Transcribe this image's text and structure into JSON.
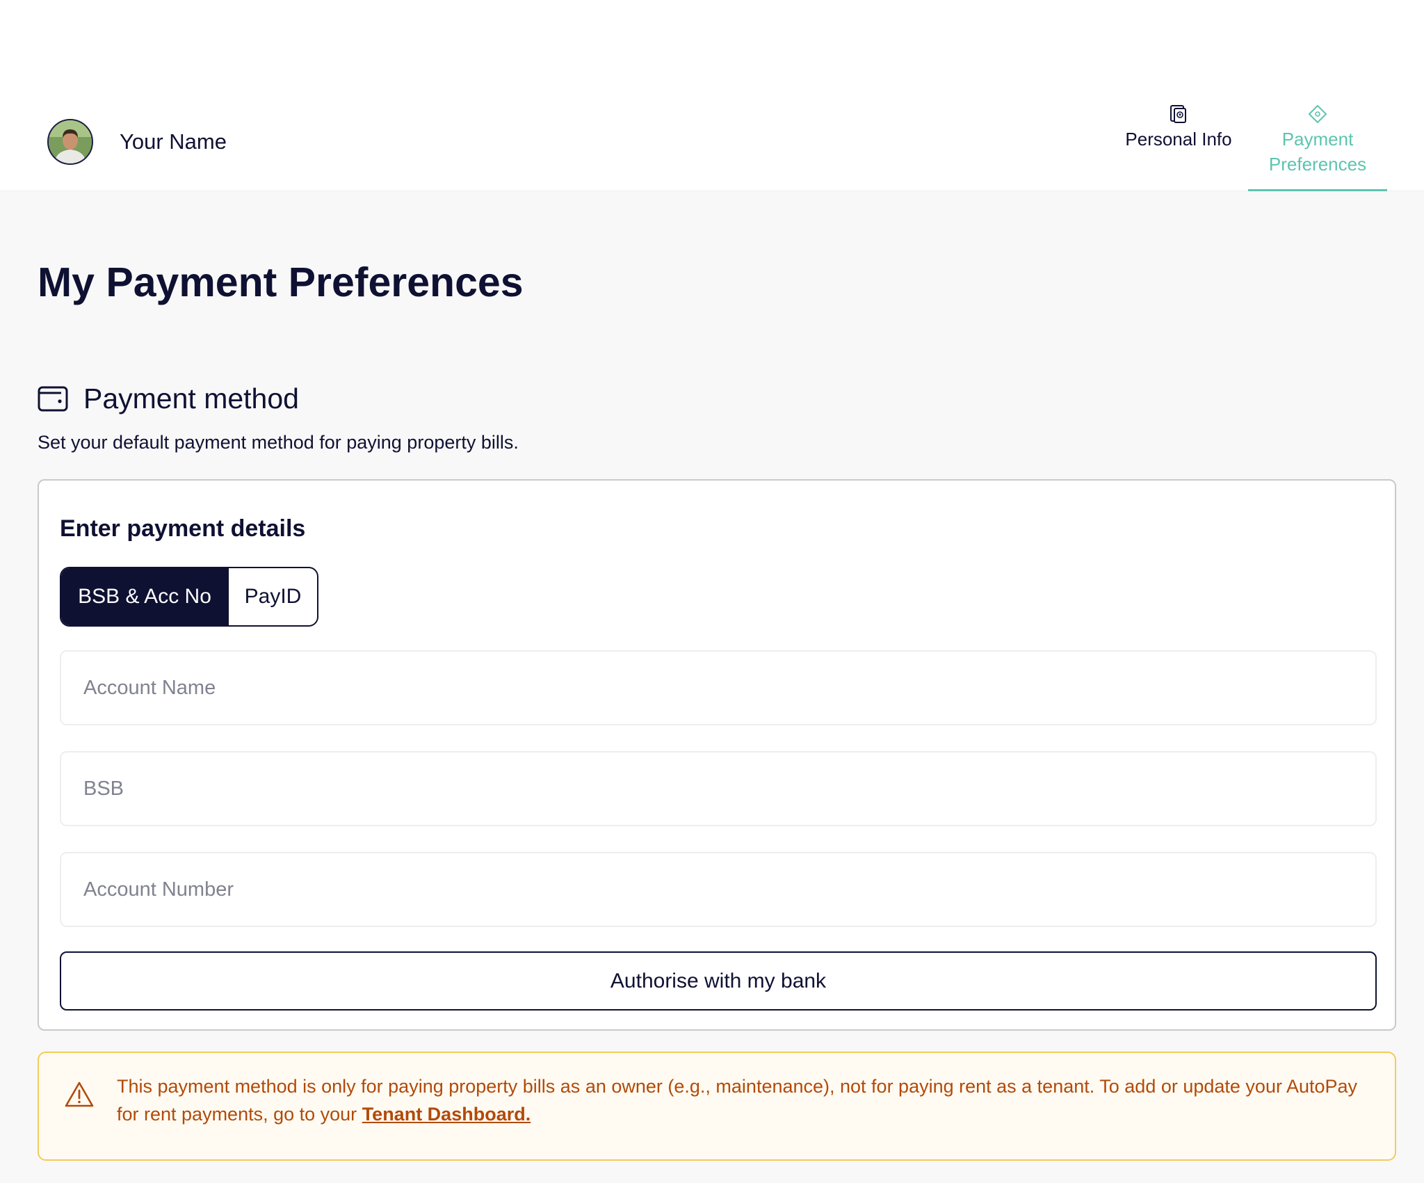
{
  "header": {
    "user_name": "Your Name",
    "tabs": [
      {
        "label": "Personal Info",
        "icon": "document-icon",
        "active": false
      },
      {
        "label": "Payment Preferences",
        "icon": "ticket-icon",
        "active": true
      }
    ]
  },
  "page_title": "My Payment Preferences",
  "payment_method": {
    "title": "Payment method",
    "icon": "wallet-icon",
    "description": "Set your default payment method for paying property bills."
  },
  "card": {
    "title": "Enter payment details",
    "toggle": {
      "options": [
        "BSB & Acc No",
        "PayID"
      ],
      "selected": "BSB & Acc No"
    },
    "fields": {
      "account_name_placeholder": "Account Name",
      "bsb_placeholder": "BSB",
      "account_number_placeholder": "Account Number"
    },
    "authorise_label": "Authorise with my bank"
  },
  "notice": {
    "icon": "warning-icon",
    "text": "This payment method is only for paying property bills as an owner (e.g., maintenance), not for paying rent as a tenant. To add or update your AutoPay for rent payments, go to your ",
    "link_label": "Tenant Dashboard."
  },
  "colors": {
    "primary": "#0f1133",
    "accent": "#5cc4b0",
    "warning_text": "#b24a0a",
    "warning_border": "#f2cb5a",
    "warning_bg": "#fffbf2"
  }
}
